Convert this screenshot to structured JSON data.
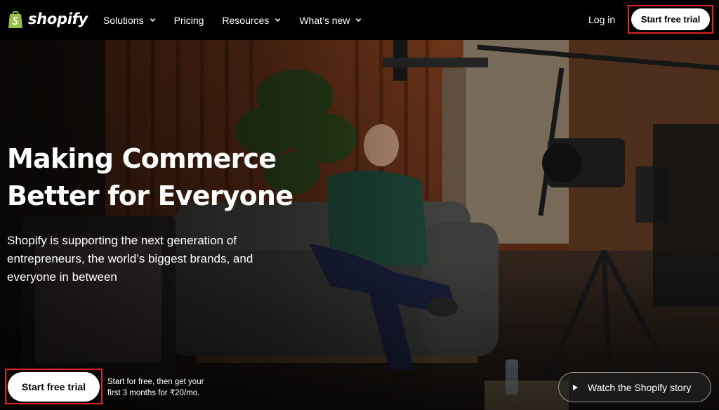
{
  "nav": {
    "logo_text": "shopify",
    "items": [
      {
        "label": "Solutions",
        "has_dropdown": true
      },
      {
        "label": "Pricing",
        "has_dropdown": false
      },
      {
        "label": "Resources",
        "has_dropdown": true
      },
      {
        "label": "What’s new",
        "has_dropdown": true
      }
    ],
    "login_label": "Log in",
    "cta_label": "Start free trial"
  },
  "hero": {
    "headline_line1": "Making Commerce",
    "headline_line2": "Better for Everyone",
    "subtext": "Shopify is supporting the next generation of entrepreneurs, the world’s biggest brands, and everyone in between",
    "cta_label": "Start free trial",
    "cta_note_line1": "Start for free, then get your",
    "cta_note_line2": "first 3 months for ₹20/mo.",
    "watch_label": "Watch the Shopify story"
  },
  "colors": {
    "highlight_border": "#e3202a",
    "nav_background": "#000000",
    "button_background": "#ffffff",
    "logo_green": "#95bf47"
  }
}
